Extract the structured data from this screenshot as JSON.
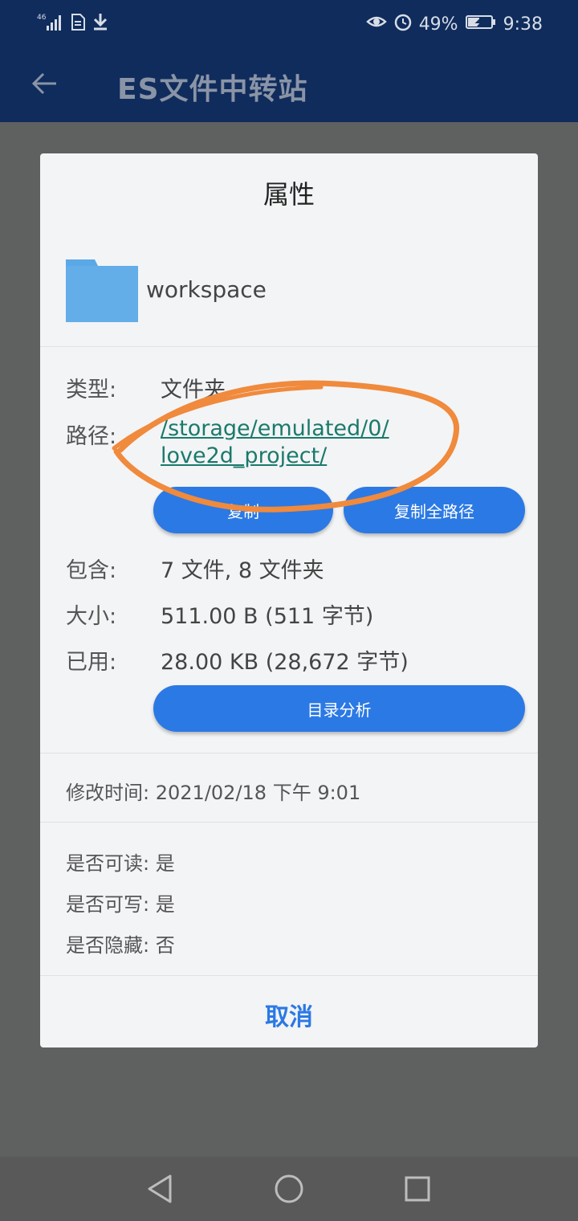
{
  "status_bar": {
    "network": "46",
    "battery": "49%",
    "time": "9:38"
  },
  "app_bar": {
    "title": "ES文件中转站"
  },
  "dialog": {
    "title": "属性",
    "item_name": "workspace",
    "type_label": "类型:",
    "type_value": "文件夹",
    "path_label": "路径:",
    "path_line1": "/storage/emulated/0/",
    "path_line2": "love2d_project/",
    "copy_button": "复制",
    "copy_full_path_button": "复制全路径",
    "contains_label": "包含:",
    "contains_value": "7 文件, 8 文件夹",
    "size_label": "大小:",
    "size_value": "511.00 B (511 字节)",
    "used_label": "已用:",
    "used_value": "28.00 KB (28,672 字节)",
    "dir_analysis_button": "目录分析",
    "modified_label": "修改时间:",
    "modified_value": "2021/02/18 下午 9:01",
    "readable_label": "是否可读:",
    "readable_value": "是",
    "writable_label": "是否可写:",
    "writable_value": "是",
    "hidden_label": "是否隐藏:",
    "hidden_value": "否",
    "cancel_button": "取消"
  },
  "colors": {
    "appbar": "#0f2c5c",
    "accent": "#2b79e4",
    "folder": "#5aa8e6",
    "link": "#1a7a6b",
    "annotation": "#f08a3c"
  },
  "icons": [
    "signal-icon",
    "sim-icon",
    "download-icon",
    "eye-icon",
    "alarm-icon",
    "battery-icon",
    "back-arrow-icon",
    "folder-icon",
    "nav-back-icon",
    "nav-home-icon",
    "nav-recents-icon"
  ]
}
